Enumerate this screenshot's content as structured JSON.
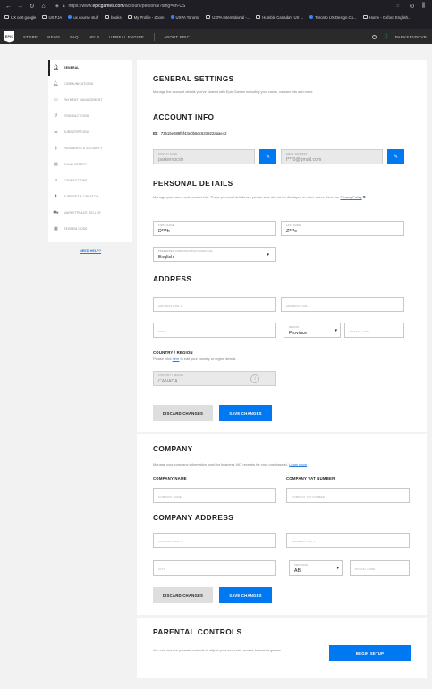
{
  "browser": {
    "url_prefix": "https://www.",
    "url_domain": "epicgames.com",
    "url_path": "/account/personal?lang=en-US",
    "bookmarks": [
      "UX cert google",
      "UX FJA",
      "ux course stuff",
      "books",
      "My Profile - Zoom",
      "UXPA Toronto",
      "UXPA International -...",
      "Humble Canada's UX ...",
      "Toronto UX Design Co...",
      "Home - Oxford English..."
    ]
  },
  "epic_nav": {
    "logo": "EPIC",
    "items": [
      "STORE",
      "NEWS",
      "FAQ",
      "HELP",
      "UNREAL ENGINE"
    ],
    "about": "ABOUT EPIC",
    "username": "PARKERVBCVB"
  },
  "sidebar": {
    "items": [
      {
        "label": "GENERAL",
        "icon": "person-icon"
      },
      {
        "label": "COMMUNICATIONS",
        "icon": "bell-icon"
      },
      {
        "label": "PAYMENT MANAGEMENT",
        "icon": "card-icon"
      },
      {
        "label": "TRANSACTIONS",
        "icon": "history-icon"
      },
      {
        "label": "SUBSCRIPTIONS",
        "icon": "list-icon"
      },
      {
        "label": "PASSWORD & SECURITY",
        "icon": "key-icon"
      },
      {
        "label": "EULA HISTORY",
        "icon": "document-icon"
      },
      {
        "label": "CONNECTIONS",
        "icon": "share-icon"
      },
      {
        "label": "SUPPORT-A-CREATOR",
        "icon": "creator-icon"
      },
      {
        "label": "MARKETPLACE SELLER",
        "icon": "seller-icon"
      },
      {
        "label": "REDEEM CODE",
        "icon": "gift-icon"
      }
    ],
    "help": "NEED HELP?"
  },
  "general": {
    "title": "GENERAL SETTINGS",
    "desc": "Manage the account details you've shared with Epic Games including your name, contact info and more",
    "account_info_title": "ACCOUNT INFO",
    "id_label": "ID:",
    "id_value": "73615e888f5f43e0b6ec633922aaae42",
    "display_name_label": "DISPLAY NAME",
    "display_name_value": "parkervbcvb",
    "email_label": "EMAIL ADDRESS",
    "email_value": "f***0@gmail.com",
    "personal_title": "PERSONAL DETAILS",
    "personal_desc": "Manage your name and contact info. These personal details are private and will not be displayed to other users. View our",
    "privacy_link": "Privacy Policy",
    "first_name_label": "FIRST NAME",
    "first_name_value": "D***h",
    "last_name_label": "LAST NAME",
    "last_name_value": "Z***c",
    "language_label": "PREFERRED COMMUNICATION LANGUAGE",
    "language_value": "English",
    "address_title": "ADDRESS",
    "address1_ph": "ADDRESS LINE 1",
    "address2_ph": "ADDRESS LINE 2",
    "city_ph": "CITY",
    "region_label": "REGION",
    "region_value": "Province",
    "postal_ph": "POSTAL CODE",
    "country_title": "COUNTRY / REGION",
    "country_desc_pre": "Please click",
    "country_link": "here",
    "country_desc_post": "to edit your country or region details.",
    "country_label": "COUNTRY / REGION",
    "country_value": "CANADA",
    "discard": "DISCARD CHANGES",
    "save": "SAVE CHANGES"
  },
  "company": {
    "title": "COMPANY",
    "desc": "Manage your company information used for business VAT receipts for your purchase(s).",
    "learn_more": "Learn more",
    "name_head": "COMPANY NAME",
    "vat_head": "COMPANY VAT NUMBER",
    "name_ph": "COMPANY NAME",
    "vat_ph": "COMPANY VAT NUMBER",
    "address_title": "COMPANY ADDRESS",
    "address1_ph": "ADDRESS LINE 1",
    "address2_ph": "ADDRESS LINE 2",
    "city_ph": "CITY",
    "region_label": "PROVINCE",
    "region_value": "AB",
    "postal_ph": "POSTAL CODE",
    "discard": "DISCARD CHANGES",
    "save": "SAVE CHANGES"
  },
  "parental": {
    "title": "PARENTAL CONTROLS",
    "desc": "You can use the parental controls to adjust your account's access to mature games.",
    "button": "BEGIN SETUP"
  }
}
